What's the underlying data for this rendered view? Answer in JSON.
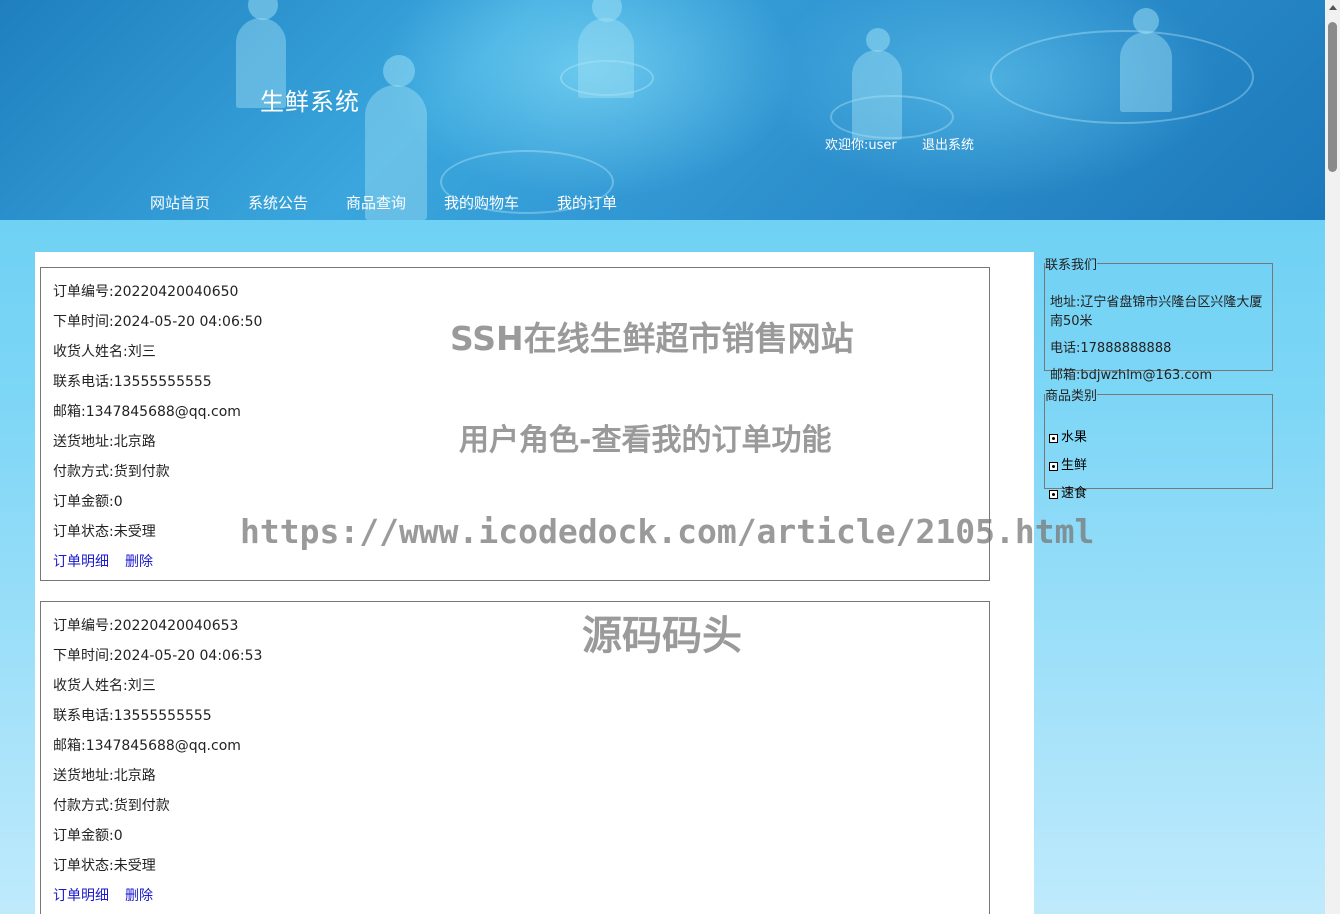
{
  "header": {
    "site_title": "生鲜系统",
    "welcome_prefix": "欢迎你:",
    "username": "user",
    "logout": "退出系统"
  },
  "nav": [
    "网站首页",
    "系统公告",
    "商品查询",
    "我的购物车",
    "我的订单"
  ],
  "orders": [
    {
      "lines": [
        "订单编号:20220420040650",
        "下单时间:2024-05-20 04:06:50",
        "收货人姓名:刘三",
        "联系电话:13555555555",
        "邮箱:1347845688@qq.com",
        "送货地址:北京路",
        "付款方式:货到付款",
        "订单金额:0",
        "订单状态:未受理"
      ],
      "detail_link": "订单明细",
      "delete_link": "删除"
    },
    {
      "lines": [
        "订单编号:20220420040653",
        "下单时间:2024-05-20 04:06:53",
        "收货人姓名:刘三",
        "联系电话:13555555555",
        "邮箱:1347845688@qq.com",
        "送货地址:北京路",
        "付款方式:货到付款",
        "订单金额:0",
        "订单状态:未受理"
      ],
      "detail_link": "订单明细",
      "delete_link": "删除"
    }
  ],
  "watermark": {
    "line1": "SSH在线生鲜超市销售网站",
    "line2": "用户角色-查看我的订单功能",
    "line3": "https://www.icodedock.com/article/2105.html",
    "line4": "源码码头"
  },
  "sidebar": {
    "contact": {
      "legend": "联系我们",
      "address": "地址:辽宁省盘锦市兴隆台区兴隆大厦南50米",
      "phone": "电话:17888888888",
      "email": "邮箱:bdjwzhlm@163.com"
    },
    "categories": {
      "legend": "商品类别",
      "items": [
        "水果",
        "生鲜",
        "速食"
      ]
    }
  }
}
